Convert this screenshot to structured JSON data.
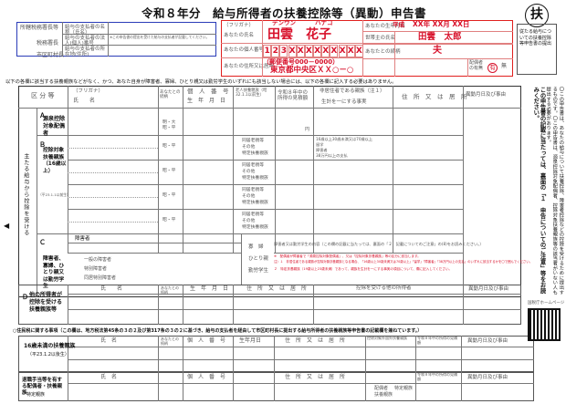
{
  "form": {
    "title": "令和８年分　給与所得者の扶養控除等（異動）申告書",
    "stamp": "扶"
  },
  "header_left": {
    "row1": "所轄税務署長等",
    "row2": "税務署長",
    "row3": "市区町村長",
    "payer_name_label": "給与の支払者の名称（氏名）",
    "payer_no_label": "給与の支払者の法人(個人)番号",
    "payer_no_note": "※この申告書の提出を受けた給与の支払者が記載してください。",
    "payer_addr_label": "給与の支払者の所在地(住所)"
  },
  "applicant": {
    "furigana_label": "（フリガナ）",
    "name_label": "あなたの氏名",
    "furigana_sei": "デンウン",
    "furigana_mei": "ハナコ",
    "name": "田雲　花子",
    "mynumber_label": "あなたの個人番号",
    "mynumber": "123XXXXXXXXX",
    "address_label": "あなたの住所又は居所",
    "postal": "（郵便番号000－0000）",
    "address": "東京都中央区ＸＸ○－○",
    "birth_label": "あなたの生年月日",
    "birth_era": "平成",
    "birth_date": "XX年 XX月 XX日",
    "householder_label": "世帯主の氏名",
    "householder": "田雲　太郎",
    "relation_label": "あなたとの続柄",
    "relation": "夫",
    "spouse_label": "配偶者の有無",
    "spouse_yes": "有",
    "spouse_no": "無",
    "residence_note": "従たる給与についての扶養控除等申告書の提出",
    "residence_note2": "（提出している場合には、〇印を付けてください。）"
  },
  "notice": "以下の各欄に該当する扶養親族などがなく、かつ、あなた自身が障害者、寡婦、ひとり親又は勤労学生のいずれにも該当しない場合には、以下の各欄に記入する必要はありません。",
  "main_table": {
    "col_category": "区 分 等",
    "col_furigana": "（フリガナ）",
    "col_name": "氏　　名",
    "col_relation": "あなたとの続柄",
    "col_mynumber": "個　人　番　号",
    "col_birth": "生　年　月　日",
    "col_person_type": "老人扶養親族（昭32.1.1以前生）",
    "col_income": "令和８年中の所得の見積額",
    "col_nonresident": "非居住者である親族（注１）",
    "col_separate": "生計を一にする事実",
    "col_address": "住　所　又　は　居　所",
    "col_change": "異動月日及び事由",
    "section_A": "Ａ",
    "section_A_label": "源泉控除対象配偶者",
    "section_B": "Ｂ",
    "section_B_label": "控除対象扶養親族（16歳以上）",
    "section_B_sub": "（平23.1.1以前生）",
    "section_C": "Ｃ",
    "section_C_label": "障害者、寡婦、ひとり親又は勤労学生",
    "section_side": "主たる給与から控除を受ける",
    "section_D": "Ｄ",
    "section_D_label": "他の所得者が控除を受ける扶養親族等",
    "era_options": "明・大　昭・平",
    "era_options2": "昭・平",
    "era_options3": "平・令",
    "rel_options_1": "同居老親等",
    "rel_options_2": "その他",
    "rel_options_3": "特定扶養親族",
    "nonres_1": "16歳以上30歳未満又は70歳以上",
    "nonres_2": "留学",
    "nonres_3": "障害者",
    "nonres_4": "38万円以上の支払",
    "yen": "円",
    "c_disability": "障害者",
    "c_general": "一般の障害者",
    "c_special": "特別障害者",
    "c_cohab": "同居特別障害者",
    "c_widow": "寡　婦",
    "c_single": "ひとり親",
    "c_student": "勤労学生",
    "c_deduction": "区分",
    "c_self": "本人",
    "c_spouse": "同一生計配偶者",
    "c_dependent": "扶養親族",
    "c_note": "障害者又は勤労学生の内容（この欄の記載に当たっては、裏面の「２　記載についてのご注意」の(8)をお読みください。）",
    "c_person": "人",
    "note_1": "※　配偶者が障害者で「源泉控除対象配偶者」、又は「控除対象扶養親族」等の区分に該当します。",
    "note_2": "注）１　非居住者である親族が控除対象扶養親族となる場合、「16歳以上30歳未満又は70歳以上」「留学」「障害者」「38万円以上の支払」のいずれに該当するかを〇で囲んでください。",
    "note_3": "２　特定扶養親族（19歳以上23歳未満）であって、親族を生計を一にする事実の項目について、欄に記入してください。",
    "d_name": "氏　　名",
    "d_relation": "あなたとの続柄",
    "d_birth": "生　年　月　日",
    "d_address": "住　所　又　は　居　所",
    "d_other": "控除を受ける他の所得者",
    "d_other_name": "氏　名",
    "d_other_rel": "あなたとの続柄",
    "d_other_addr": "住所又は居所",
    "d_change": "異動月日及び事由"
  },
  "resident_tax": {
    "header": "○住民税に関する事項（この欄は、地方税法第45条の３の２及び第317条の３の２に基づき、給与の支払者を経由して市区町村長に提出する給与所得者の扶養親族等申告書の記載欄を兼ねています。）",
    "under16_label": "16歳未満の扶養親族",
    "under16_sub": "（平23.1.2以後生）",
    "col_furigana": "（フリガナ）",
    "col_name": "氏　名",
    "col_relation": "あなたとの続柄",
    "col_mynumber": "個　人　番　号",
    "col_birth": "生年月日",
    "col_address": "住　所　又　は　居　所",
    "col_nonres": "控除対象外国外扶養親族",
    "col_income": "令和８年中の所得の見積額",
    "col_change": "異動月日及び事由",
    "retire_label": "退職手当等を有する配偶者・扶養親族",
    "retire_sub": "・特定親族",
    "col_retire_income": "令和８年中の所得の見積額",
    "col_retire_type": "区分",
    "opt_spouse": "配偶者",
    "opt_family": "扶養親族",
    "opt_specific": "特定親族",
    "era_heisei_reiwa": "平・令",
    "era_meiji": "明・大・昭・平",
    "disabled_label": "障害者",
    "widow_opt": "寡婦",
    "single_opt": "ひとり親"
  },
  "side_notes": {
    "main": "この申告書の記載に当たっては、裏面の「１　申告についてのご注意」等をお読みください。",
    "sub": "〇この申告書は、あなたの給与について扶養控除、障害者控除などの控除を受けるために提出するものです。〇この申告書は、源泉控除対象配偶者、控除対象扶養親族等の該当者がいない人も提出する必要があります。",
    "qr_label": "国税庁ホームページ"
  },
  "marker": "◀"
}
